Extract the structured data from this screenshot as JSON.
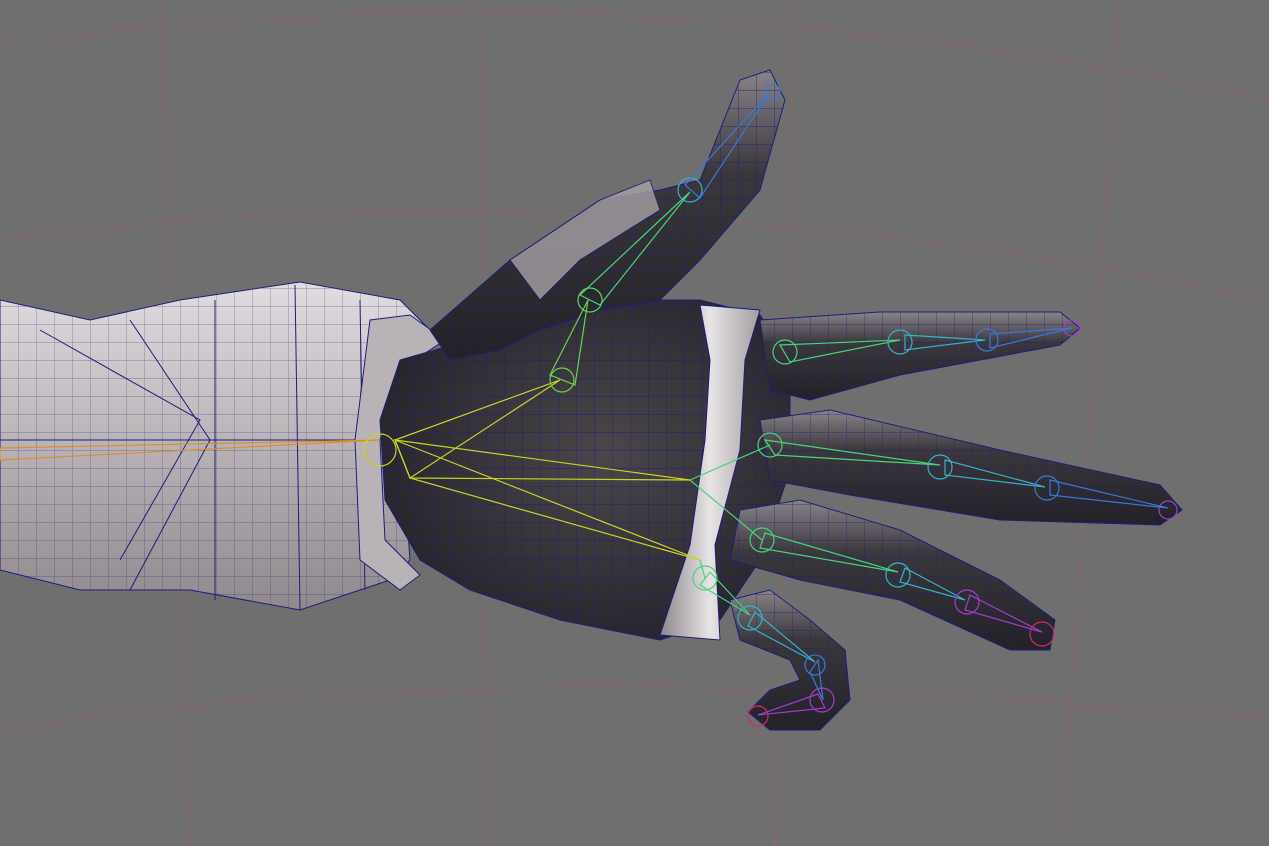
{
  "viewport": {
    "background": "#6f6f6f",
    "grid_color": "#c85a5a",
    "wire_color": "#1c1f78",
    "mesh_light": "#d8d3d6",
    "mesh_dark": "#2f2d33",
    "bone_colors": {
      "arm": "#d8902a",
      "wrist": "#c8d22a",
      "palm": "#9ed238",
      "proximal": "#4ad27a",
      "middle": "#3ab0c8",
      "distal": "#3a78d8",
      "tip": "#a040c8",
      "tip_red": "#d02a6a"
    }
  }
}
